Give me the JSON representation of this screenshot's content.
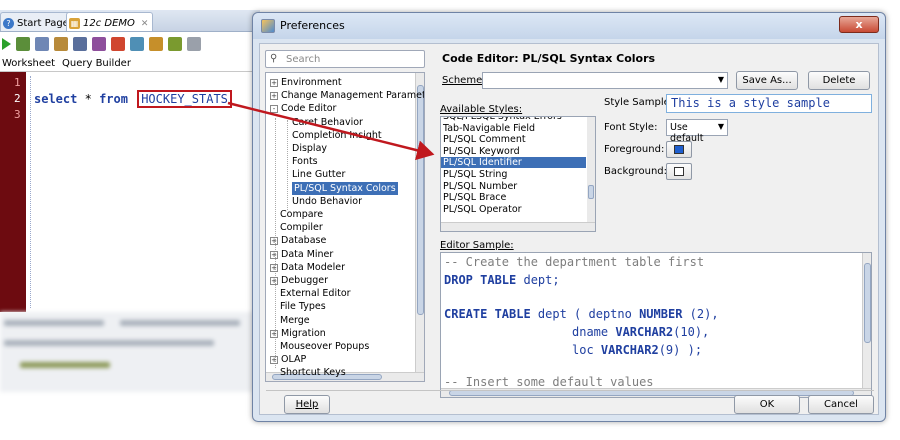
{
  "ide": {
    "tabs": [
      {
        "label": "Start Page"
      },
      {
        "label": "12c DEMO"
      }
    ],
    "subtabs": [
      "Worksheet",
      "Query Builder"
    ],
    "line_numbers": [
      "1",
      "2",
      "3"
    ],
    "code": {
      "keyword1": "select",
      "star": "*",
      "keyword2": "from",
      "table": "HOCKEY_STATS"
    }
  },
  "dialog": {
    "title": "Preferences",
    "close_glyph": "x",
    "search_placeholder": "Search",
    "tree": [
      {
        "label": "Environment",
        "level": 0,
        "expander": "+"
      },
      {
        "label": "Change Management Parameters",
        "level": 0,
        "expander": "+"
      },
      {
        "label": "Code Editor",
        "level": 0,
        "expander": "-"
      },
      {
        "label": "Caret Behavior",
        "level": 1
      },
      {
        "label": "Completion Insight",
        "level": 1
      },
      {
        "label": "Display",
        "level": 1
      },
      {
        "label": "Fonts",
        "level": 1
      },
      {
        "label": "Line Gutter",
        "level": 1
      },
      {
        "label": "PL/SQL Syntax Colors",
        "level": 1,
        "selected": true
      },
      {
        "label": "Undo Behavior",
        "level": 1
      },
      {
        "label": "Compare",
        "level": 0
      },
      {
        "label": "Compiler",
        "level": 0
      },
      {
        "label": "Database",
        "level": 0,
        "expander": "+"
      },
      {
        "label": "Data Miner",
        "level": 0,
        "expander": "+"
      },
      {
        "label": "Data Modeler",
        "level": 0,
        "expander": "+"
      },
      {
        "label": "Debugger",
        "level": 0,
        "expander": "+"
      },
      {
        "label": "External Editor",
        "level": 0
      },
      {
        "label": "File Types",
        "level": 0
      },
      {
        "label": "Merge",
        "level": 0
      },
      {
        "label": "Migration",
        "level": 0,
        "expander": "+"
      },
      {
        "label": "Mouseover Popups",
        "level": 0
      },
      {
        "label": "OLAP",
        "level": 0,
        "expander": "+"
      },
      {
        "label": "Shortcut Keys",
        "level": 0
      }
    ],
    "panel_title": "Code Editor: PL/SQL Syntax Colors",
    "scheme_label": "Scheme:",
    "scheme_value": "",
    "save_as_label": "Save As...",
    "delete_label": "Delete",
    "available_styles_label": "Available Styles:",
    "styles": [
      "SQL/PLSQL Syntax Errors",
      "Tab-Navigable Field",
      "PL/SQL Comment",
      "PL/SQL Keyword",
      "PL/SQL Identifier",
      "PL/SQL String",
      "PL/SQL Number",
      "PL/SQL Brace",
      "PL/SQL Operator"
    ],
    "selected_style": "PL/SQL Identifier",
    "style_sample_label": "Style Sample:",
    "style_sample_text": "This is a style sample",
    "font_style_label": "Font Style:",
    "font_style_value": "Use default",
    "foreground_label": "Foreground:",
    "background_label": "Background:",
    "foreground_color": "#1f5fcf",
    "background_color": "#ffffff",
    "editor_sample_label": "Editor Sample:",
    "editor_sample": {
      "l1": "-- Create the department table first",
      "l2_kw": "DROP TABLE",
      "l2_id": " dept;",
      "l4_kw": "CREATE TABLE",
      "l4_id": " dept ( deptno ",
      "l4_type": "NUMBER",
      "l4_rest": " (2),",
      "l5_id": "dname ",
      "l5_type": "VARCHAR2",
      "l5_rest": "(10),",
      "l6_id": "loc ",
      "l6_type": "VARCHAR2",
      "l6_rest": "(9) );",
      "l8": "-- Insert some default values"
    },
    "help_label": "Help",
    "ok_label": "OK",
    "cancel_label": "Cancel"
  },
  "colors": {
    "accent_red": "#c0181e",
    "selection_blue": "#3d6fb6",
    "gutter": "#6d0b10"
  }
}
